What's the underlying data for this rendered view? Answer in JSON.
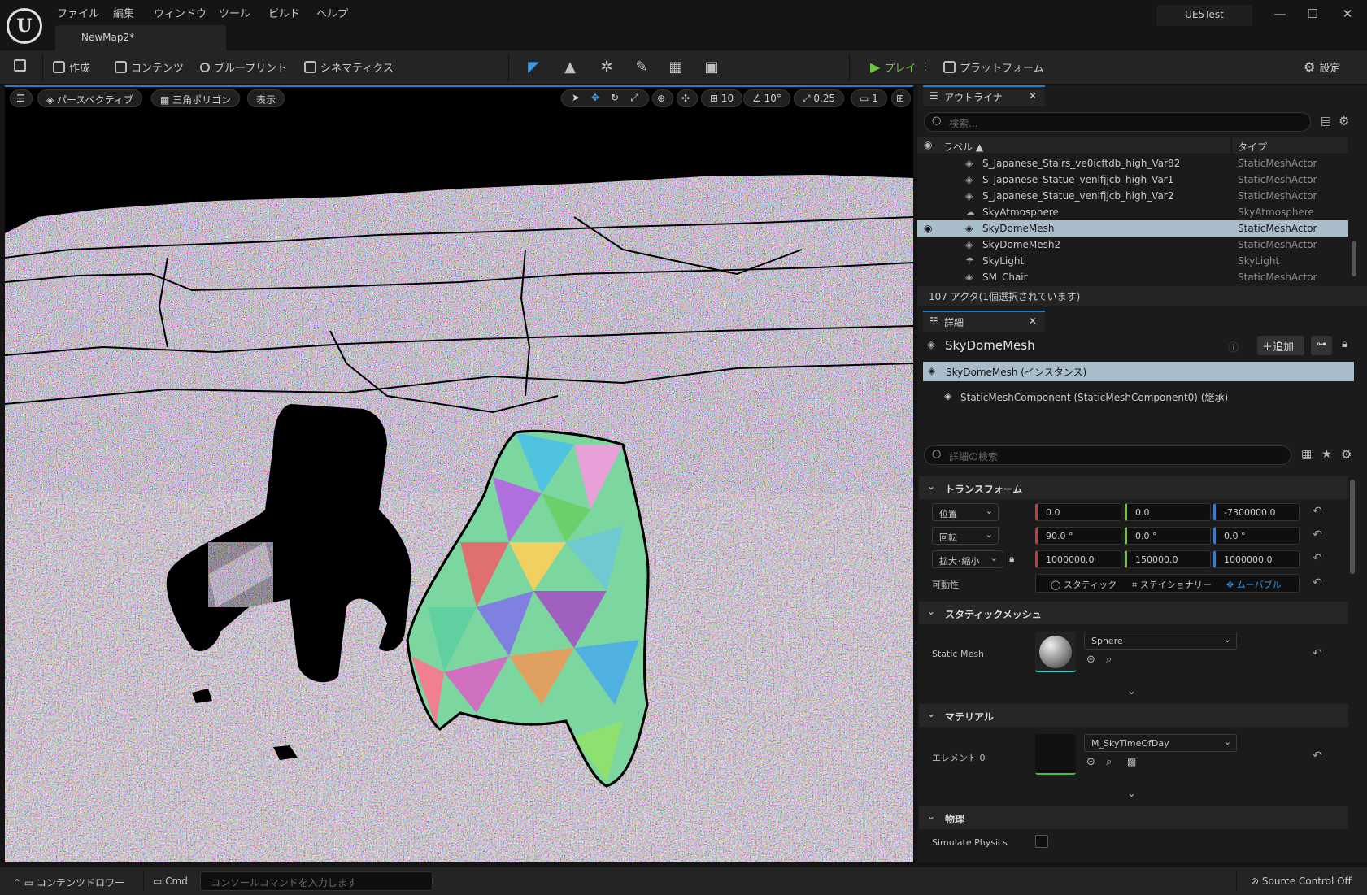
{
  "menu": [
    "ファイル",
    "編集",
    "ウィンドウ",
    "ツール",
    "ビルド",
    "ヘルプ"
  ],
  "document_tab": "NewMap2*",
  "project_name": "UE5Test",
  "toolbar": {
    "create": "作成",
    "content": "コンテンツ",
    "blueprint": "ブループリント",
    "cinematics": "シネマティクス",
    "play": "プレイ",
    "platform": "プラットフォーム",
    "settings": "設定"
  },
  "viewport": {
    "perspective": "パースペクティブ",
    "view_mode": "三角ポリゴン",
    "show": "表示",
    "grid_snap": "10",
    "rotation_snap": "10°",
    "scale_snap": "0.25",
    "camera_speed": "1"
  },
  "outliner": {
    "tab": "アウトライナ",
    "search_placeholder": "検索...",
    "col_label": "ラベル",
    "col_type": "タイプ",
    "rows": [
      {
        "label": "S_Japanese_Stairs_ve0icftdb_high_Var82",
        "type": "StaticMeshActor",
        "icon": "static-mesh-icon"
      },
      {
        "label": "S_Japanese_Statue_venlfjjcb_high_Var1",
        "type": "StaticMeshActor",
        "icon": "static-mesh-icon"
      },
      {
        "label": "S_Japanese_Statue_venlfjjcb_high_Var2",
        "type": "StaticMeshActor",
        "icon": "static-mesh-icon"
      },
      {
        "label": "SkyAtmosphere",
        "type": "SkyAtmosphere",
        "icon": "sky-atmosphere-icon"
      },
      {
        "label": "SkyDomeMesh",
        "type": "StaticMeshActor",
        "icon": "static-mesh-icon"
      },
      {
        "label": "SkyDomeMesh2",
        "type": "StaticMeshActor",
        "icon": "static-mesh-icon"
      },
      {
        "label": "SkyLight",
        "type": "SkyLight",
        "icon": "sky-light-icon"
      },
      {
        "label": "SM_Chair",
        "type": "StaticMeshActor",
        "icon": "static-mesh-icon"
      }
    ],
    "selected_index": 4,
    "footer": "107 アクタ(1個選択されています)"
  },
  "details": {
    "tab": "詳細",
    "actor_name": "SkyDomeMesh",
    "add_button": "追加",
    "instance_row": "SkyDomeMesh (インスタンス)",
    "component_row": "StaticMeshComponent (StaticMeshComponent0) (継承)",
    "search_placeholder": "詳細の検索",
    "transform": {
      "title": "トランスフォーム",
      "location_label": "位置",
      "location": [
        "0.0",
        "0.0",
        "-7300000.0"
      ],
      "rotation_label": "回転",
      "rotation": [
        "90.0 °",
        "0.0 °",
        "0.0 °"
      ],
      "scale_label": "拡大･縮小",
      "scale": [
        "1000000.0",
        "150000.0",
        "1000000.0"
      ],
      "mobility_label": "可動性",
      "mobility_options": [
        "スタティック",
        "ステイショナリー",
        "ムーバブル"
      ],
      "mobility_selected": 2
    },
    "static_mesh_section": {
      "title": "スタティックメッシュ",
      "label": "Static Mesh",
      "value": "Sphere"
    },
    "material_section": {
      "title": "マテリアル",
      "label": "エレメント 0",
      "value": "M_SkyTimeOfDay"
    },
    "physics_section": {
      "title": "物理",
      "simulate_label": "Simulate Physics"
    }
  },
  "statusbar": {
    "content_drawer": "コンテンツドロワー",
    "cmd": "Cmd",
    "console_placeholder": "コンソールコマンドを入力します",
    "source_control": "Source Control Off"
  },
  "colors": {
    "accent": "#1e7ec8",
    "play_green": "#6ac83a",
    "selection": "#a9bcc9",
    "panel_bg": "#242424"
  }
}
